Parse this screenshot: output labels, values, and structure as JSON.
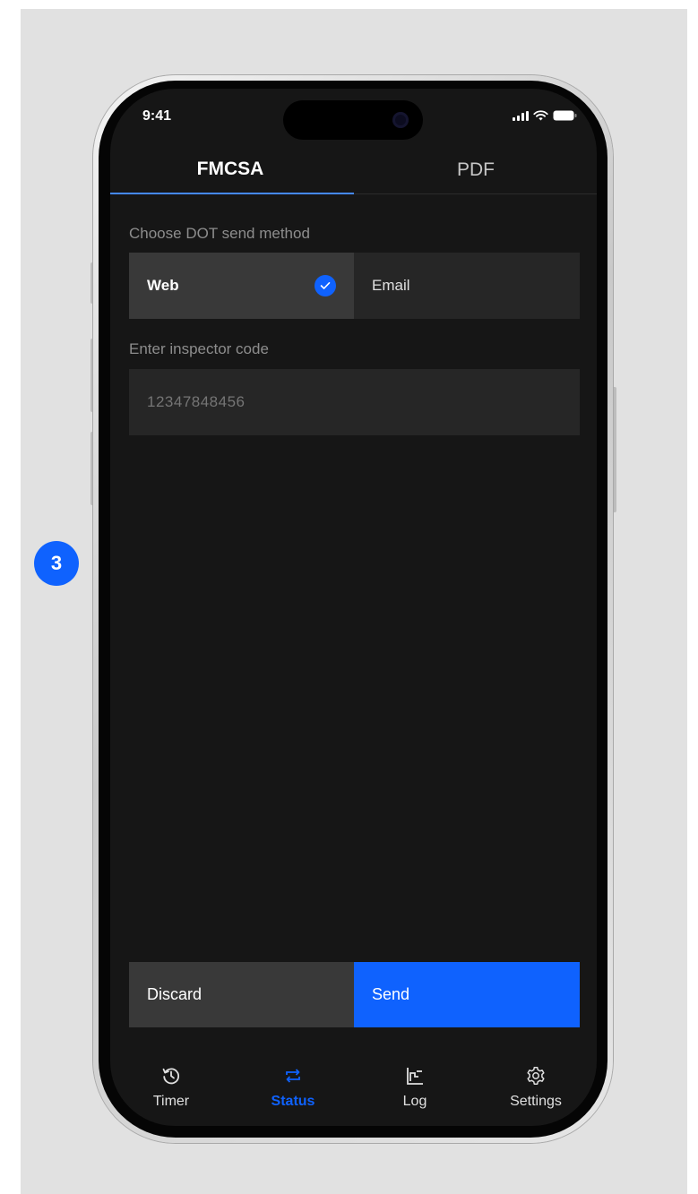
{
  "step_badge": "3",
  "status_bar": {
    "time": "9:41"
  },
  "tabs": [
    {
      "label": "FMCSA",
      "active": true
    },
    {
      "label": "PDF",
      "active": false
    }
  ],
  "send_method": {
    "label": "Choose DOT send method",
    "options": [
      {
        "label": "Web",
        "selected": true
      },
      {
        "label": "Email",
        "selected": false
      }
    ]
  },
  "inspector_code": {
    "label": "Enter inspector code",
    "placeholder": "12347848456"
  },
  "actions": {
    "discard": "Discard",
    "send": "Send"
  },
  "bottom_nav": [
    {
      "label": "Timer",
      "icon": "clock-history-icon",
      "active": false
    },
    {
      "label": "Status",
      "icon": "swap-arrows-icon",
      "active": true
    },
    {
      "label": "Log",
      "icon": "log-chart-icon",
      "active": false
    },
    {
      "label": "Settings",
      "icon": "gear-icon",
      "active": false
    }
  ],
  "colors": {
    "accent": "#0f62fe",
    "screen_bg": "#161616",
    "tile_selected": "#393939",
    "tile": "#262626"
  }
}
